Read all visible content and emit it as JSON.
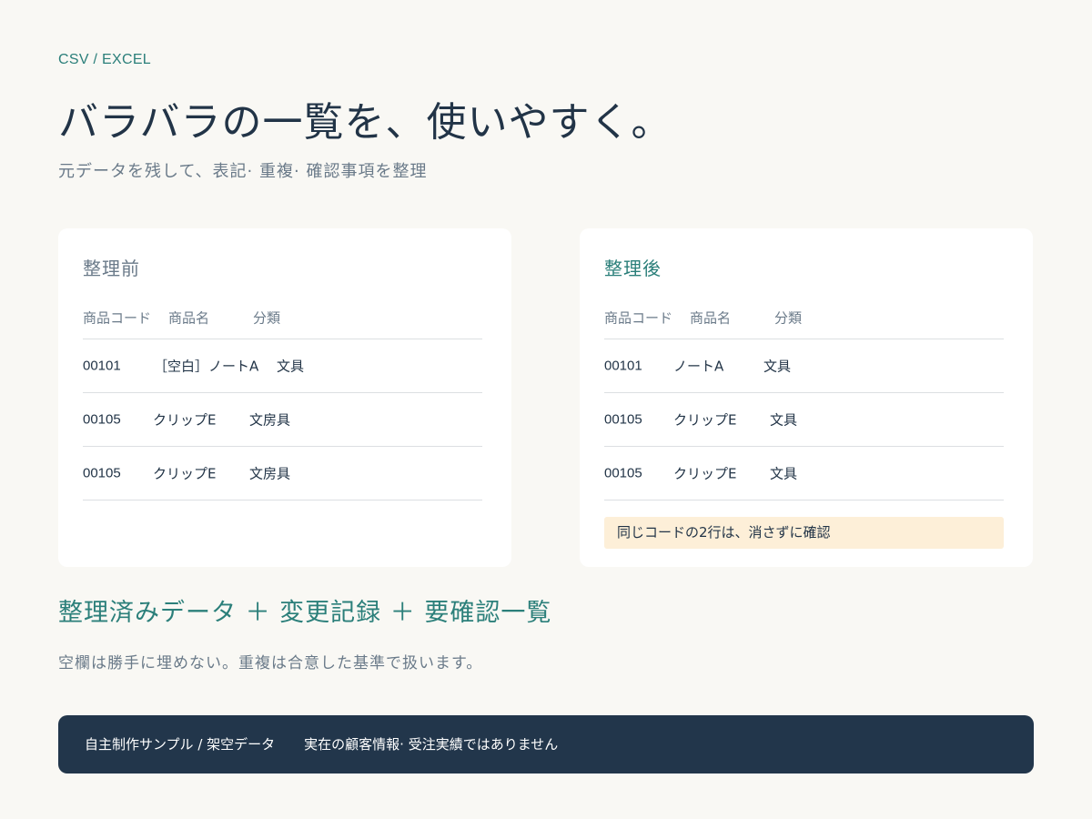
{
  "eyebrow": "CSV / EXCEL",
  "title": "バラバラの一覧を、使いやすく。",
  "subtitle": "元データを残して、表記· 重複· 確認事項を整理",
  "before": {
    "title": "整理前",
    "headers": [
      "商品コード",
      "商品名",
      "分類"
    ],
    "rows": [
      [
        "00101",
        "［空白］ノートA",
        "文具"
      ],
      [
        "00105",
        "クリップE",
        "文房具"
      ],
      [
        "00105",
        "クリップE",
        "文房具"
      ]
    ]
  },
  "after": {
    "title": "整理後",
    "headers": [
      "商品コード",
      "商品名",
      "分類"
    ],
    "rows": [
      [
        "00101",
        "ノートA",
        "文具"
      ],
      [
        "00105",
        "クリップE",
        "文具"
      ],
      [
        "00105",
        "クリップE",
        "文具"
      ]
    ],
    "note": "同じコードの2行は、消さずに確認"
  },
  "summary": "整理済みデータ ＋ 変更記録 ＋ 要確認一覧",
  "summary_note": "空欄は勝手に埋めない。重複は合意した基準で扱います。",
  "footer": {
    "left": "自主制作サンプル / 架空データ",
    "right": "実在の顧客情報· 受注実績ではありません"
  },
  "colors": {
    "background": "#f9f8f4",
    "accent": "#2b7f7a",
    "navy": "#22364b",
    "note_bg": "#fdefd8"
  }
}
